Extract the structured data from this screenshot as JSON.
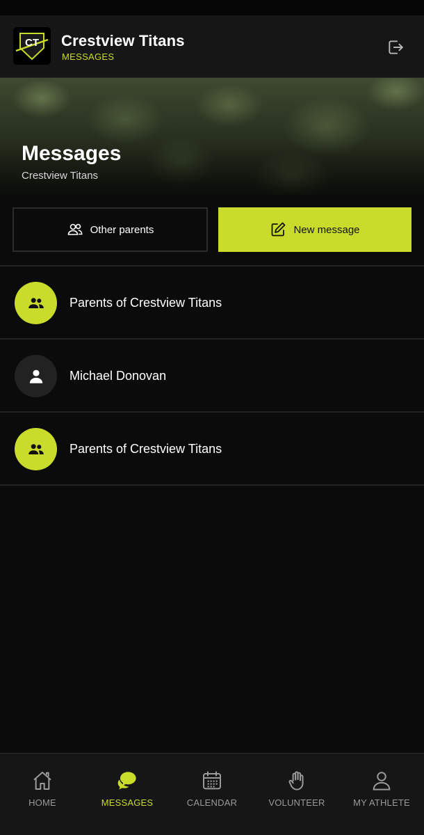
{
  "header": {
    "logo_text": "CT",
    "team_name": "Crestview Titans",
    "section": "MESSAGES",
    "logout_icon": "logout-icon"
  },
  "hero": {
    "title": "Messages",
    "subtitle": "Crestview Titans"
  },
  "actions": {
    "other_parents_label": "Other parents",
    "other_parents_icon": "people-icon",
    "new_message_label": "New message",
    "new_message_icon": "compose-icon"
  },
  "conversations": [
    {
      "name": "Parents of Crestview Titans",
      "type": "group"
    },
    {
      "name": "Michael Donovan",
      "type": "person"
    },
    {
      "name": "Parents of Crestview Titans",
      "type": "group"
    }
  ],
  "bottom_nav": {
    "items": [
      {
        "label": "HOME",
        "icon": "home-icon",
        "active": false
      },
      {
        "label": "MESSAGES",
        "icon": "chat-bubbles-icon",
        "active": true
      },
      {
        "label": "CALENDAR",
        "icon": "calendar-icon",
        "active": false
      },
      {
        "label": "VOLUNTEER",
        "icon": "raised-hand-icon",
        "active": false
      },
      {
        "label": "MY ATHLETE",
        "icon": "user-icon",
        "active": false
      }
    ]
  },
  "colors": {
    "accent": "#c9dc2b",
    "background": "#0b0b0b",
    "surface": "#161616"
  }
}
